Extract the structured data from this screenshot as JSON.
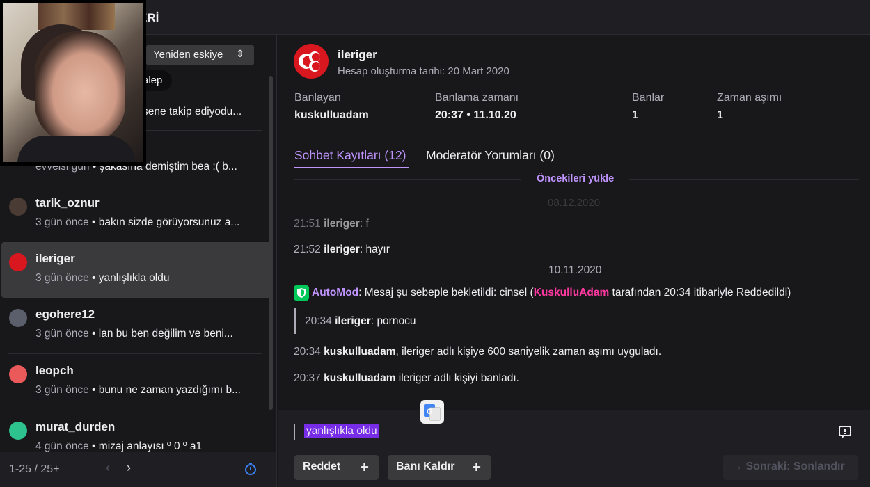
{
  "header": {
    "title": "ERİ"
  },
  "left": {
    "sort_label": "Yeniden eskiye",
    "sort_chevron": "⇕",
    "pill_label": "alep",
    "items": [
      {
        "name": "",
        "time": "",
        "message": "sene takip ediyodu...",
        "avatar_color": "#6c6c74"
      },
      {
        "name": "",
        "time": "evvelsi gün",
        "message": "şakasına demiştim bea :( b...",
        "avatar_color": "#6c6c74"
      },
      {
        "name": "tarik_oznur",
        "time": "3 gün önce",
        "message": "bakın sizde görüyorsunuz a...",
        "avatar_color": "#4a3b34"
      },
      {
        "name": "ileriger",
        "time": "3 gün önce",
        "message": "yanlışlıkla oldu",
        "avatar_color": "#d9171e"
      },
      {
        "name": "egohere12",
        "time": "3 gün önce",
        "message": "lan bu ben değilim ve beni...",
        "avatar_color": "#5a5f6b"
      },
      {
        "name": "leopch",
        "time": "3 gün önce",
        "message": "bunu ne zaman yazdığımı b...",
        "avatar_color": "#eb5a5a"
      },
      {
        "name": "murat_durden",
        "time": "4 gün önce",
        "message": "mizaj anlayısı º 0 º a1",
        "avatar_color": "#2ec28e"
      }
    ],
    "separator": "•",
    "pager_count": "1-25 / 25+",
    "prev_icon": "‹",
    "next_icon": "›"
  },
  "profile": {
    "name": "ileriger",
    "created": "Hesap oluşturma tarihi: 20 Mart 2020",
    "stats": [
      {
        "label": "Banlayan",
        "value": "kuskulluadam"
      },
      {
        "label": "Banlama zamanı",
        "value": "20:37 • 11.10.20"
      },
      {
        "label": "Banlar",
        "value": "1"
      },
      {
        "label": "Zaman aşımı",
        "value": "1"
      }
    ]
  },
  "tabs": [
    {
      "label": "Sohbet Kayıtları (12)",
      "active": true
    },
    {
      "label": "Moderatör Yorumları (0)",
      "active": false
    }
  ],
  "chat": {
    "load_previous": "Öncekileri yükle",
    "ghost_date": "08.12.2020",
    "messages": [
      {
        "time": "21:51",
        "user": "ileriger",
        "text": "f"
      },
      {
        "time": "21:52",
        "user": "ileriger",
        "text": "hayır"
      }
    ],
    "date_separator": "10.11.2020",
    "automod": {
      "name": "AutoMod",
      "text1": ": Mesaj şu sebeple bekletildi: cinsel (",
      "moderator": "KuskulluAdam",
      "text2": " tarafından 20:34 itibariyle Reddedildi)"
    },
    "held_message": {
      "time": "20:34",
      "user": "ileriger",
      "text": "pornocu"
    },
    "events": [
      {
        "time": "20:34",
        "user": "kuskulluadam",
        "text": ", ileriger adlı kişiye 600 saniyelik zaman aşımı uyguladı."
      },
      {
        "time": "20:37",
        "user": "kuskulluadam",
        "text": " ileriger adlı kişiyi banladı."
      }
    ]
  },
  "composer": {
    "value": "yanlışlıkla oldu"
  },
  "actions": {
    "reject": "Reddet",
    "unban": "Banı Kaldır",
    "next": "Sonraki: Sonlandır",
    "plus": "+",
    "next_arrow": "→"
  },
  "colors": {
    "accent": "#bf94ff",
    "automod_green": "#00c85a",
    "moderator_pink": "#ff38a0",
    "profile_red": "#d9171e",
    "selection": "#772ce8"
  }
}
